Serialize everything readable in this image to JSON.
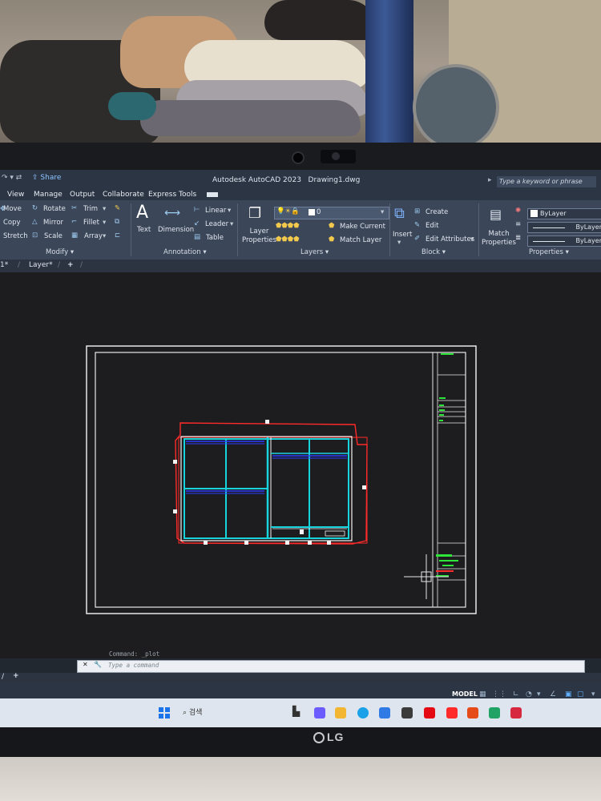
{
  "titlebar": {
    "share": "Share",
    "app_title": "Autodesk AutoCAD 2023",
    "doc_title": "Drawing1.dwg",
    "search_placeholder": "Type a keyword or phrase"
  },
  "menu": [
    "View",
    "Manage",
    "Output",
    "Collaborate",
    "Express Tools"
  ],
  "ribbon": {
    "modify": {
      "title": "Modify",
      "items": [
        "Move",
        "Rotate",
        "Trim",
        "Copy",
        "Mirror",
        "Fillet",
        "Stretch",
        "Scale",
        "Array"
      ]
    },
    "annotation": {
      "title": "Annotation",
      "text": "Text",
      "dimension": "Dimension",
      "linear": "Linear",
      "leader": "Leader",
      "table": "Table"
    },
    "layers": {
      "title": "Layers",
      "layer_properties": "Layer\nProperties",
      "current_layer": "0",
      "make_current": "Make Current",
      "match_layer": "Match Layer"
    },
    "block": {
      "title": "Block",
      "insert": "Insert",
      "create": "Create",
      "edit": "Edit",
      "edit_attributes": "Edit Attributes"
    },
    "properties": {
      "title": "Properties",
      "match": "Match\nProperties",
      "color": "ByLayer",
      "linetype": "ByLayer",
      "lineweight": "ByLayer"
    }
  },
  "doc_tabs": [
    "1*",
    "Layer*"
  ],
  "command": {
    "history": "Command: _plot",
    "placeholder": "Type a command"
  },
  "statusbar": {
    "mode": "MODEL"
  },
  "taskbar": {
    "search": "검색"
  },
  "laptop_brand": "LG",
  "colors": {
    "drawing_white": "#f2f2f2",
    "cyan": "#19d3dc",
    "red": "#ff2a2a",
    "blue": "#2a3cff",
    "green": "#2ee63a"
  }
}
